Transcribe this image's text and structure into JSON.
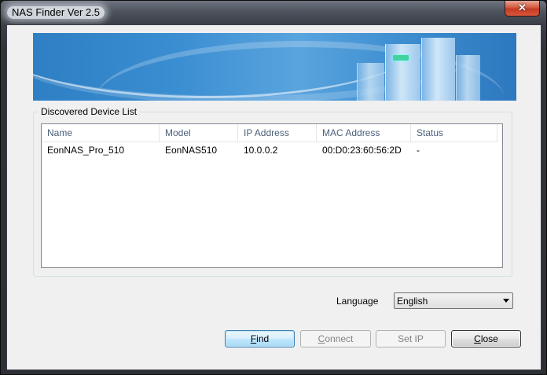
{
  "window": {
    "title": "NAS Finder Ver 2.5",
    "close_glyph": "✕"
  },
  "device_list": {
    "group_label": "Discovered Device List",
    "columns": [
      "Name",
      "Model",
      "IP Address",
      "MAC Address",
      "Status"
    ],
    "rows": [
      {
        "name": "EonNAS_Pro_510",
        "model": "EonNAS510",
        "ip": "10.0.0.2",
        "mac": "00:D0:23:60:56:2D",
        "status": "-"
      }
    ]
  },
  "language": {
    "label": "Language",
    "selected": "English"
  },
  "buttons": {
    "find": {
      "first": "F",
      "rest": "ind"
    },
    "connect": {
      "first": "C",
      "rest": "onnect"
    },
    "set_ip": "Set IP",
    "close": {
      "first": "C",
      "rest": "lose"
    }
  },
  "colors": {
    "accent": "#3c7fb1",
    "banner": "#3b8ed2",
    "close_button": "#c23b22"
  }
}
